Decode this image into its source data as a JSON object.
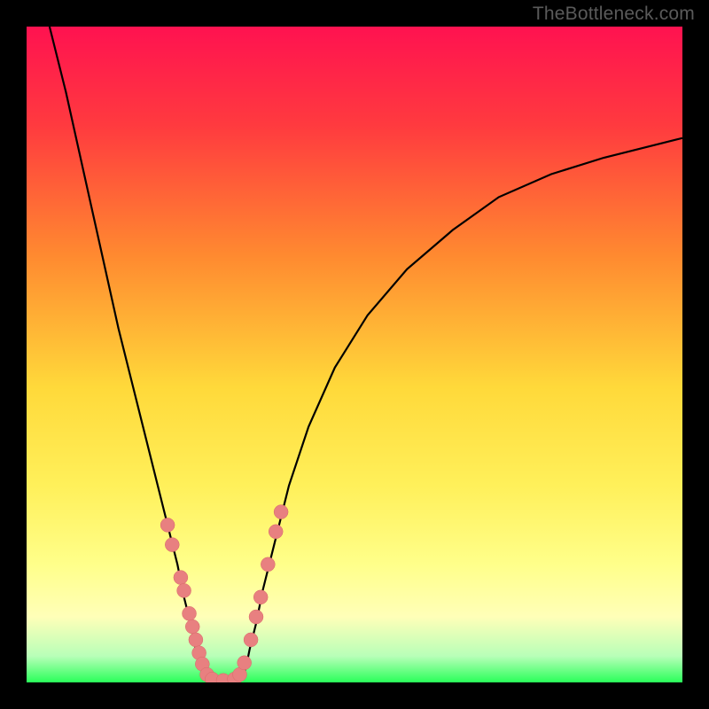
{
  "attribution": "TheBottleneck.com",
  "chart_data": {
    "type": "line",
    "title": "",
    "xlabel": "",
    "ylabel": "",
    "xlim": [
      0,
      100
    ],
    "ylim": [
      0,
      100
    ],
    "background_gradient": {
      "stops": [
        {
          "offset": 0.0,
          "color": "#ff1250"
        },
        {
          "offset": 0.15,
          "color": "#ff3a3f"
        },
        {
          "offset": 0.35,
          "color": "#ff8a30"
        },
        {
          "offset": 0.55,
          "color": "#ffd93a"
        },
        {
          "offset": 0.7,
          "color": "#fff05a"
        },
        {
          "offset": 0.82,
          "color": "#ffff8a"
        },
        {
          "offset": 0.9,
          "color": "#ffffb8"
        },
        {
          "offset": 0.96,
          "color": "#b8ffb8"
        },
        {
          "offset": 1.0,
          "color": "#2aff5a"
        }
      ]
    },
    "series": [
      {
        "name": "left-branch",
        "x": [
          3.5,
          6,
          8,
          10,
          12,
          14,
          16,
          18,
          20,
          21.5,
          23,
          24,
          25,
          25.8,
          26.5,
          27,
          27.5
        ],
        "y": [
          100,
          90,
          81,
          72,
          63,
          54,
          46,
          38,
          30,
          24,
          18,
          13,
          9,
          5,
          2.5,
          1,
          0.3
        ]
      },
      {
        "name": "valley-floor",
        "x": [
          27.5,
          28.5,
          30,
          31.5,
          32.5
        ],
        "y": [
          0.3,
          0.1,
          0.05,
          0.1,
          0.3
        ]
      },
      {
        "name": "right-branch",
        "x": [
          32.5,
          33,
          33.5,
          34,
          35,
          36,
          38,
          40,
          43,
          47,
          52,
          58,
          65,
          72,
          80,
          88,
          96,
          100
        ],
        "y": [
          0.3,
          1,
          2.5,
          5,
          9,
          14,
          22,
          30,
          39,
          48,
          56,
          63,
          69,
          74,
          77.5,
          80,
          82,
          83
        ]
      }
    ],
    "markers": {
      "name": "highlighted-points",
      "color": "#e88080",
      "radius": 8,
      "points": [
        {
          "x": 21.5,
          "y": 24
        },
        {
          "x": 22.2,
          "y": 21
        },
        {
          "x": 23.5,
          "y": 16
        },
        {
          "x": 24.0,
          "y": 14
        },
        {
          "x": 24.8,
          "y": 10.5
        },
        {
          "x": 25.3,
          "y": 8.5
        },
        {
          "x": 25.8,
          "y": 6.5
        },
        {
          "x": 26.3,
          "y": 4.5
        },
        {
          "x": 26.8,
          "y": 2.8
        },
        {
          "x": 27.5,
          "y": 1.2
        },
        {
          "x": 28.3,
          "y": 0.5
        },
        {
          "x": 30.0,
          "y": 0.3
        },
        {
          "x": 31.7,
          "y": 0.5
        },
        {
          "x": 32.5,
          "y": 1.2
        },
        {
          "x": 33.2,
          "y": 3.0
        },
        {
          "x": 34.2,
          "y": 6.5
        },
        {
          "x": 35.0,
          "y": 10
        },
        {
          "x": 35.7,
          "y": 13
        },
        {
          "x": 36.8,
          "y": 18
        },
        {
          "x": 38.0,
          "y": 23
        },
        {
          "x": 38.8,
          "y": 26
        }
      ]
    }
  }
}
